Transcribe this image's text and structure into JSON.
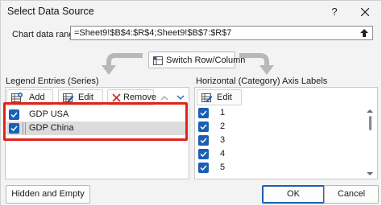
{
  "window": {
    "title": "Select Data Source",
    "help_label": "?"
  },
  "range": {
    "label": "Chart data range:",
    "value": "=Sheet9!$B$4:$R$4;Sheet9!$B$7:$R$7"
  },
  "switch_button": {
    "label": "Switch Row/Column"
  },
  "legend": {
    "heading": "Legend Entries (Series)",
    "add_label": "Add",
    "edit_label": "Edit",
    "remove_label": "Remove",
    "series": [
      {
        "name": "GDP USA",
        "checked": true
      },
      {
        "name": "GDP China",
        "checked": true
      }
    ]
  },
  "category": {
    "heading": "Horizontal (Category) Axis Labels",
    "edit_label": "Edit",
    "items": [
      {
        "label": "1",
        "checked": true
      },
      {
        "label": "2",
        "checked": true
      },
      {
        "label": "3",
        "checked": true
      },
      {
        "label": "4",
        "checked": true
      },
      {
        "label": "5",
        "checked": true
      }
    ]
  },
  "footer": {
    "hidden_cells_label": "Hidden and Empty Cells",
    "ok_label": "OK",
    "cancel_label": "Cancel"
  },
  "colors": {
    "accent": "#1a5fb4",
    "highlight": "#e2231a"
  }
}
